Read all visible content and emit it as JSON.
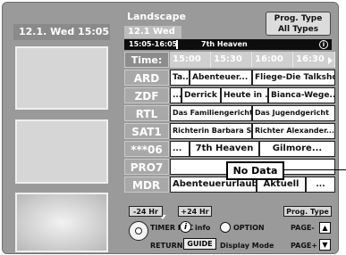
{
  "left_panel": {
    "date_time": "12.1. Wed   15:05"
  },
  "header": {
    "title": "Landscape",
    "date": "12.1 Wed",
    "prog_type_label": "Prog. Type",
    "prog_type_value": "All Types"
  },
  "info_strip": {
    "time_range": "15:05-16:05",
    "programme": "7th Heaven",
    "info_icon": "i"
  },
  "grid": {
    "time_label": "Time:",
    "times": [
      "15:00",
      "15:30",
      "16:00",
      "16:30"
    ],
    "channels": [
      {
        "name": "ARD",
        "cells": [
          "Ta...",
          "Abenteuer...",
          "Fliege-Die Talkshow"
        ]
      },
      {
        "name": "ZDF",
        "cells": [
          "...",
          "Derrick",
          "Heute in ...",
          "Bianca-Wege..."
        ]
      },
      {
        "name": "RTL",
        "cells": [
          "Das Familiengericht",
          "Das Jugendgericht"
        ]
      },
      {
        "name": "SAT1",
        "cells": [
          "Richterin Barbara Sa...",
          "Richter Alexander..."
        ]
      },
      {
        "name": "***06",
        "cells": [
          "...",
          "7th Heaven",
          "Gilmore..."
        ]
      },
      {
        "name": "PRO7",
        "cells": []
      },
      {
        "name": "MDR",
        "cells": [
          "Abenteuerurlaub",
          "Aktuell",
          "..."
        ]
      }
    ]
  },
  "no_data_label": "No Data",
  "buttons": {
    "minus24": "-24 Hr",
    "plus24": "+24 Hr",
    "prog_type": "Prog. Type",
    "timer_rec": "TIMER REC",
    "info": "info",
    "info_symbol": "i",
    "option": "OPTION",
    "page_minus": "PAGE-",
    "return": "RETURN",
    "guide": "GUIDE",
    "display_mode": "Display Mode",
    "page_plus": "PAGE+"
  }
}
